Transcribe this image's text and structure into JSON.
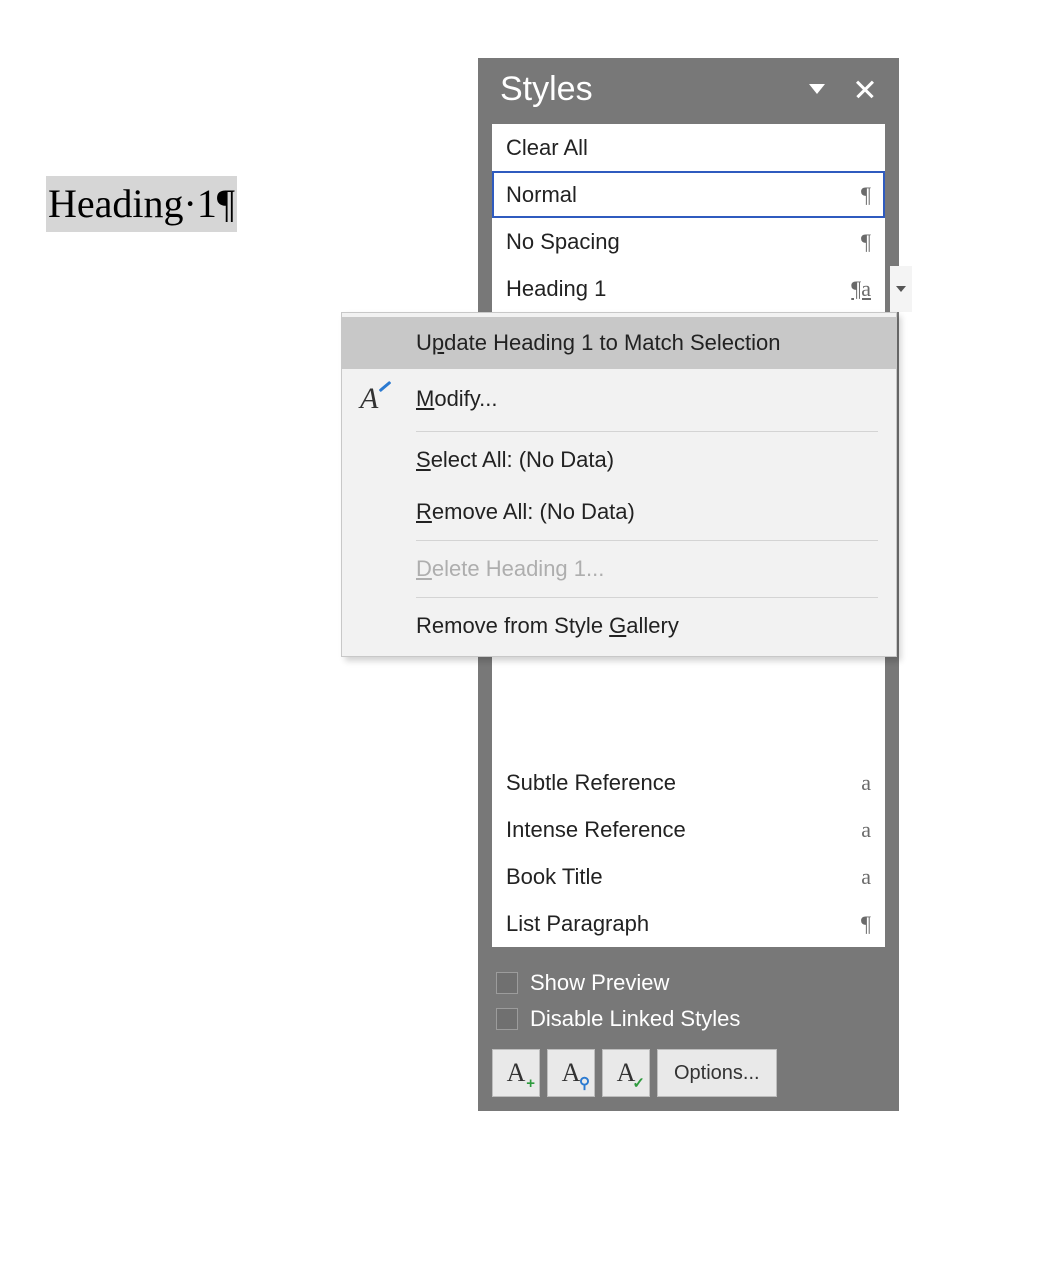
{
  "document": {
    "selected_text": "Heading·1¶"
  },
  "pane": {
    "title": "Styles",
    "items": [
      {
        "label": "Clear All",
        "badge": ""
      },
      {
        "label": "Normal",
        "badge": "¶",
        "selected": true
      },
      {
        "label": "No Spacing",
        "badge": "¶"
      },
      {
        "label": "Heading 1",
        "badge": "¶a",
        "linked": true,
        "has_dropdown": true
      },
      {
        "label": "Subtle Reference",
        "badge": "a"
      },
      {
        "label": "Intense Reference",
        "badge": "a"
      },
      {
        "label": "Book Title",
        "badge": "a"
      },
      {
        "label": "List Paragraph",
        "badge": "¶"
      }
    ],
    "show_preview_label": "Show Preview",
    "disable_linked_label": "Disable Linked Styles",
    "options_label": "Options..."
  },
  "context_menu": {
    "update": {
      "pre": "U",
      "mn": "p",
      "post": "date Heading 1 to Match Selection"
    },
    "modify": {
      "mn": "M",
      "post": "odify..."
    },
    "select": {
      "mn": "S",
      "post": "elect All: (No Data)"
    },
    "remove": {
      "mn": "R",
      "post": "emove All: (No Data)"
    },
    "delete": {
      "mn": "D",
      "post": "elete Heading 1..."
    },
    "gallery": {
      "pre": "Remove from Style ",
      "mn": "G",
      "post": "allery"
    }
  }
}
